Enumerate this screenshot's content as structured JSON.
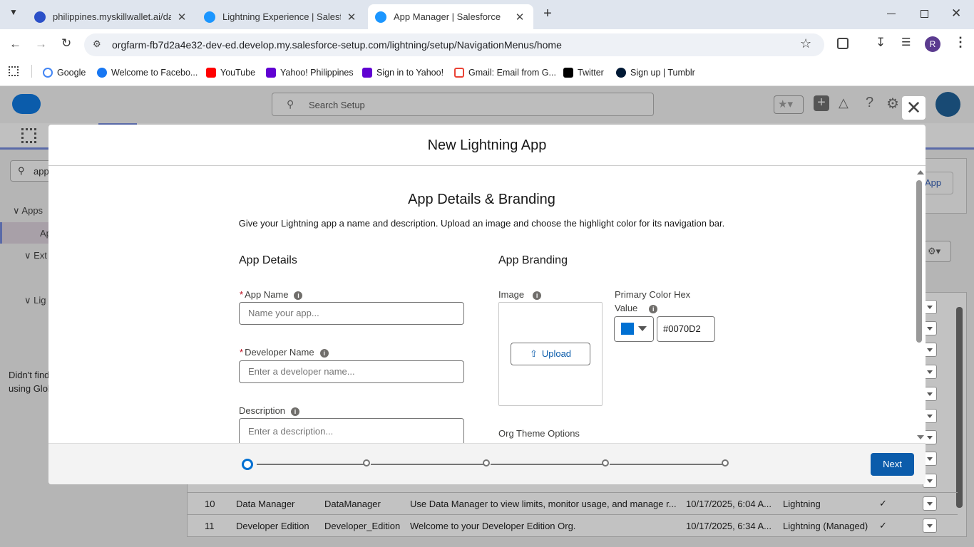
{
  "browser": {
    "tabs": [
      {
        "title": "philippines.myskillwallet.ai/dash"
      },
      {
        "title": "Lightning Experience | Salesforc"
      },
      {
        "title": "App Manager | Salesforce"
      }
    ],
    "url": "orgfarm-fb7d2a4e32-dev-ed.develop.my.salesforce-setup.com/lightning/setup/NavigationMenus/home",
    "profile_initial": "R",
    "bookmarks": [
      "Google",
      "Welcome to Facebo...",
      "YouTube",
      "Yahoo! Philippines",
      "Sign in to Yahoo!",
      "Gmail: Email from G...",
      "Twitter",
      "Sign up | Tumblr"
    ]
  },
  "sf": {
    "search_placeholder": "Search Setup",
    "quickfind_value": "app",
    "tree": [
      "Apps",
      "Ap",
      "Ext",
      "Lig"
    ],
    "didnt_find": "Didn't find",
    "using_glob": "using Glob",
    "new_app_btn": "App",
    "rows": [
      {
        "num": "10",
        "label": "Data Manager",
        "dev": "DataManager",
        "desc": "Use Data Manager to view limits, monitor usage, and manage r...",
        "date": "10/17/2025, 6:04 A...",
        "type": "Lightning"
      },
      {
        "num": "11",
        "label": "Developer Edition",
        "dev": "Developer_Edition",
        "desc": "Welcome to your Developer Edition Org.",
        "date": "10/17/2025, 6:34 A...",
        "type": "Lightning (Managed)"
      }
    ]
  },
  "modal": {
    "title": "New Lightning App",
    "section_title": "App Details & Branding",
    "intro": "Give your Lightning app a name and description. Upload an image and choose the highlight color for its navigation bar.",
    "details_heading": "App Details",
    "app_name_label": "App Name",
    "app_name_placeholder": "Name your app...",
    "dev_name_label": "Developer Name",
    "dev_name_placeholder": "Enter a developer name...",
    "desc_label": "Description",
    "desc_placeholder": "Enter a description...",
    "branding_heading": "App Branding",
    "image_label": "Image",
    "upload_label": "Upload",
    "color_label_1": "Primary Color Hex",
    "color_label_2": "Value",
    "color_value": "#0070D2",
    "org_theme_label": "Org Theme Options",
    "next_label": "Next",
    "required_mark": "*"
  },
  "colors": {
    "primary": "#0070D2",
    "brand": "#0b5cab"
  }
}
